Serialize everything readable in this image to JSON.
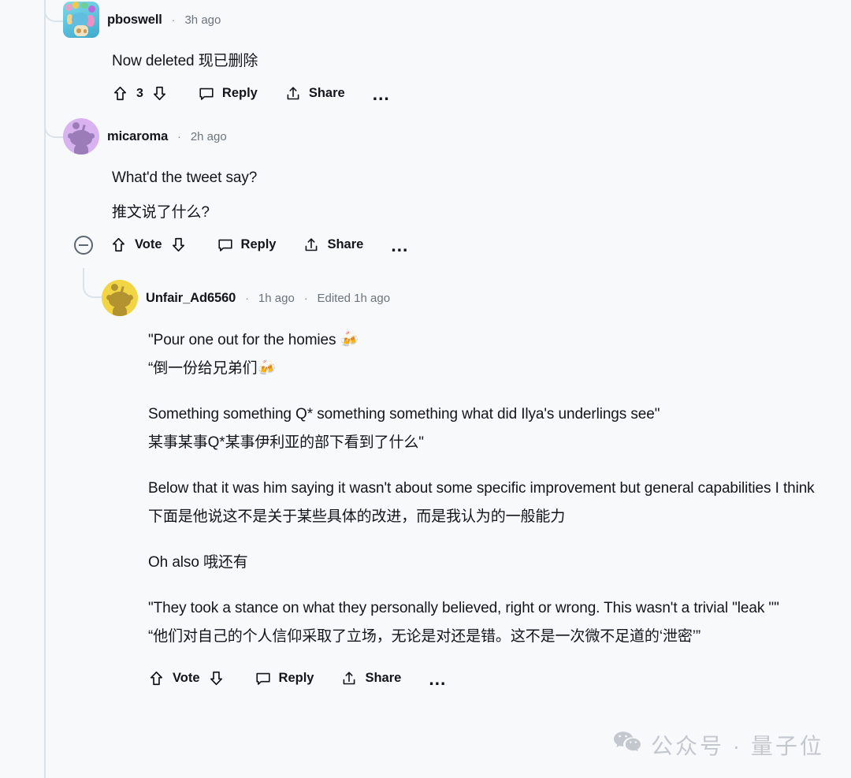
{
  "thread": {
    "comments": [
      {
        "id": "c1",
        "username": "pboswell",
        "separator": "·",
        "timestamp": "3h ago",
        "avatar_kind": "nft-hex-avatar",
        "body": [
          "Now deleted  现已删除"
        ],
        "actions": {
          "score": "3",
          "upvote_label": "upvote-icon",
          "downvote_label": "downvote-icon",
          "reply": "Reply",
          "share": "Share",
          "more": "…"
        }
      },
      {
        "id": "c2",
        "username": "micaroma",
        "separator": "·",
        "timestamp": "2h ago",
        "avatar_kind": "snoo-purple",
        "body": [
          "What'd the tweet say?",
          "推文说了什么?"
        ],
        "actions": {
          "vote_label": "Vote",
          "reply": "Reply",
          "share": "Share",
          "more": "…",
          "collapse": "collapse-thread"
        }
      },
      {
        "id": "c3",
        "username": "Unfair_Ad6560",
        "separator": "·",
        "timestamp": "1h ago",
        "separator2": "·",
        "edited": "Edited 1h ago",
        "avatar_kind": "snoo-yellow",
        "body": [
          "\"Pour one out for the homies 🍻",
          "“倒一份给兄弟们🍻",
          "Something something Q* something something what did Ilya's underlings see\"",
          "某事某事Q*某事伊利亚的部下看到了什么\"",
          "Below that it was him saying it wasn't about some specific improvement but general capabilities I think",
          "下面是他说这不是关于某些具体的改进，而是我认为的一般能力",
          "Oh also  哦还有",
          "\"They took a stance on what they personally believed, right or wrong. This wasn't a trivial \"leak \"\"",
          "“他们对自己的个人信仰采取了立场，无论是对还是错。这不是一次微不足道的‘泄密’”"
        ],
        "actions": {
          "vote_label": "Vote",
          "reply": "Reply",
          "share": "Share",
          "more": "…"
        }
      }
    ]
  },
  "watermark": {
    "icon": "wechat-icon",
    "text": "公众号 · 量子位"
  },
  "colors": {
    "background": "#f8f9fb",
    "text": "#12151a",
    "muted": "#6b747c",
    "rail": "#dbe3ea",
    "snoo_purple": "#9b7cb8",
    "snoo_purple_bg": "#d9b3f0",
    "snoo_yellow": "#b39330",
    "snoo_yellow_bg": "#f2d544",
    "watermark": "#c3c8ce"
  }
}
